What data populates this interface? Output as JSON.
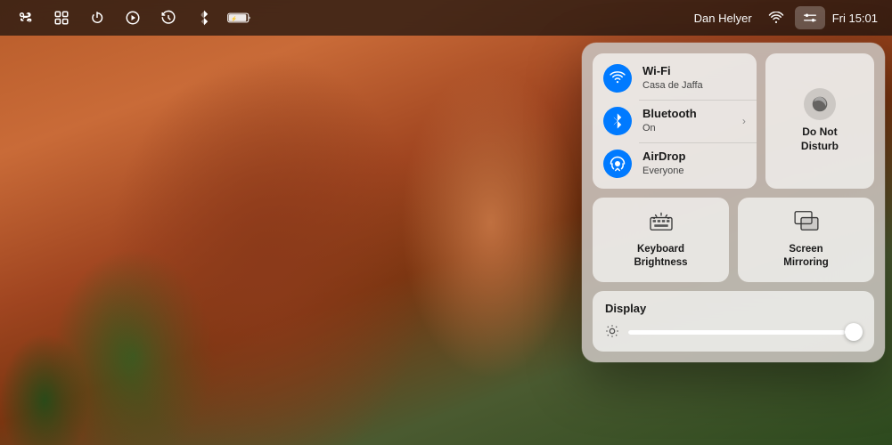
{
  "menubar": {
    "icons": [
      {
        "name": "command-icon",
        "symbol": "⌘"
      },
      {
        "name": "grid-icon",
        "symbol": "⊞"
      },
      {
        "name": "power-icon",
        "symbol": "⏻"
      },
      {
        "name": "play-icon",
        "symbol": "▶"
      },
      {
        "name": "history-icon",
        "symbol": "↺"
      },
      {
        "name": "bluetooth-menu-icon",
        "symbol": ""
      },
      {
        "name": "battery-icon",
        "symbol": "🔋"
      },
      {
        "name": "wifi-menu-icon",
        "symbol": ""
      },
      {
        "name": "control-center-icon",
        "symbol": "",
        "active": true
      }
    ],
    "username": "Dan Helyer",
    "time": "Fri 15:01"
  },
  "control_center": {
    "connectivity": {
      "items": [
        {
          "id": "wifi",
          "title": "Wi-Fi",
          "subtitle": "Casa de Jaffa",
          "has_chevron": false
        },
        {
          "id": "bluetooth",
          "title": "Bluetooth",
          "subtitle": "On",
          "has_chevron": true
        },
        {
          "id": "airdrop",
          "title": "AirDrop",
          "subtitle": "Everyone",
          "has_chevron": false
        }
      ]
    },
    "do_not_disturb": {
      "label_line1": "Do Not",
      "label_line2": "Disturb"
    },
    "tiles": [
      {
        "id": "keyboard-brightness",
        "label_line1": "Keyboard",
        "label_line2": "Brightness"
      },
      {
        "id": "screen-mirroring",
        "label_line1": "Screen",
        "label_line2": "Mirroring"
      }
    ],
    "display": {
      "title": "Display",
      "brightness_value": 95
    }
  }
}
